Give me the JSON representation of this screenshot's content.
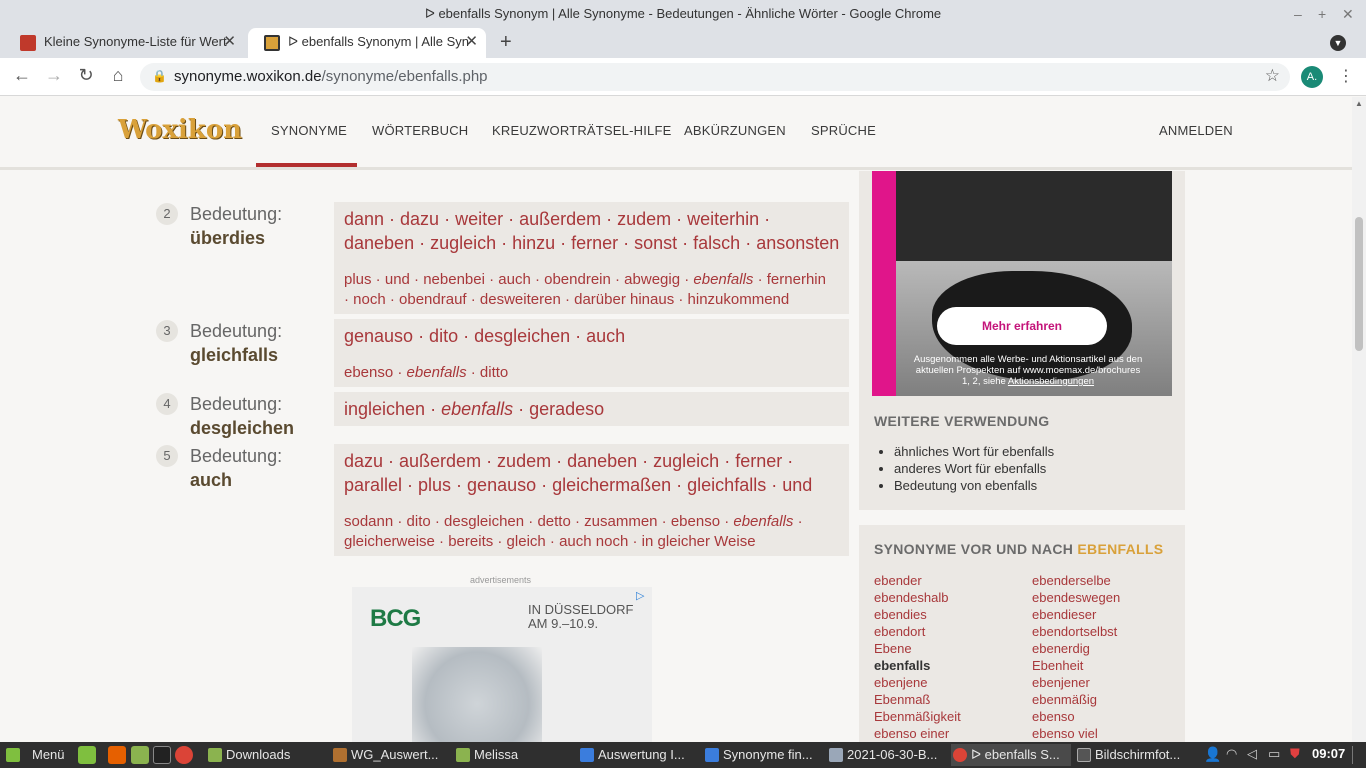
{
  "window": {
    "title": "ᐅ ebenfalls Synonym | Alle Synonyme - Bedeutungen - Ähnliche Wörter - Google Chrome"
  },
  "tabs": [
    {
      "label": "Kleine Synonyme-Liste für Wert",
      "active": false
    },
    {
      "label": "ᐅ ebenfalls Synonym | Alle Syn",
      "active": true
    }
  ],
  "toolbar": {
    "url_domain": "synonyme.woxikon.de",
    "url_path": "/synonyme/ebenfalls.php",
    "avatar": "A."
  },
  "site": {
    "logo": "Woxikon",
    "nav": [
      "SYNONYME",
      "WÖRTERBUCH",
      "KREUZWORTRÄTSEL-HILFE",
      "ABKÜRZUNGEN",
      "SPRÜCHE"
    ],
    "login": "ANMELDEN"
  },
  "meanings": [
    {
      "num": "2",
      "label": "Bedeutung:",
      "word": "überdies",
      "main_line1": "dann · dazu · weiter · außerdem · zudem · weiterhin ·",
      "main_line2": "daneben · zugleich · hinzu · ferner · sonst · falsch · ansonsten",
      "sub_line1_a": "plus · und · nebenbei · auch · obendrein · abwegig · ",
      "sub_line1_em": "ebenfalls",
      "sub_line1_b": " · fernerhin",
      "sub_line2": " · noch · obendrauf · desweiteren · darüber hinaus · hinzukommend"
    },
    {
      "num": "3",
      "label": "Bedeutung:",
      "word": "gleichfalls",
      "main_line1": "genauso · dito · desgleichen · auch",
      "sub_line1_a": "ebenso · ",
      "sub_line1_em": "ebenfalls",
      "sub_line1_b": " · ditto"
    },
    {
      "num": "4",
      "label": "Bedeutung:",
      "word": "desgleichen",
      "main_a": "ingleichen · ",
      "main_em": "ebenfalls",
      "main_b": " · geradeso"
    },
    {
      "num": "5",
      "label": "Bedeutung:",
      "word": "auch",
      "main_line1": "dazu · außerdem · zudem · daneben · zugleich · ferner ·",
      "main_line2": "parallel · plus · genauso · gleichermaßen · gleichfalls · und",
      "sub_line1_a": "sodann · dito · desgleichen · detto · zusammen · ebenso · ",
      "sub_line1_em": "ebenfalls",
      "sub_line1_b": " ·",
      "sub_line2": "gleicherweise · bereits · gleich · auch noch · in gleicher Weise"
    }
  ],
  "ad_right": {
    "button": "Mehr erfahren",
    "fine_line1": "Ausgenommen alle Werbe- und Aktionsartikel aus den",
    "fine_line2": "aktuellen Prospekten auf www.moemax.de/brochures",
    "fine_line3_a": "1, 2, siehe ",
    "fine_line3_link": "Aktionsbedingungen"
  },
  "sidebar": {
    "usage_title": "WEITERE VERWENDUNG",
    "usage_items": [
      "ähnliches Wort für ebenfalls",
      "anderes Wort für ebenfalls",
      "Bedeutung von ebenfalls"
    ],
    "neighbors_title": "SYNONYME VOR UND NACH ",
    "neighbors_title_word": "EBENFALLS",
    "col1": [
      "ebender",
      "ebendeshalb",
      "ebendies",
      "ebendort",
      "Ebene",
      "ebenfalls",
      "ebenjene",
      "Ebenmaß",
      "Ebenmäßigkeit",
      "ebenso einer"
    ],
    "col2": [
      "ebenderselbe",
      "ebendeswegen",
      "ebendieser",
      "ebendortselbst",
      "ebenerdig",
      "Ebenheit",
      "ebenjener",
      "ebenmäßig",
      "ebenso",
      "ebenso viel"
    ]
  },
  "ad_bottom": {
    "label": "advertisements",
    "brand": "BCG",
    "text_line1": "IN DÜSSELDORF",
    "text_line2": "AM 9.–10.9."
  },
  "taskbar": {
    "menu": "Menü",
    "items": [
      "Downloads",
      "WG_Auswert...",
      "Melissa",
      "Auswertung I...",
      "Synonyme fin...",
      "2021-06-30-B...",
      "ᐅ ebenfalls S...",
      "Bildschirmfot..."
    ],
    "clock": "09:07"
  }
}
